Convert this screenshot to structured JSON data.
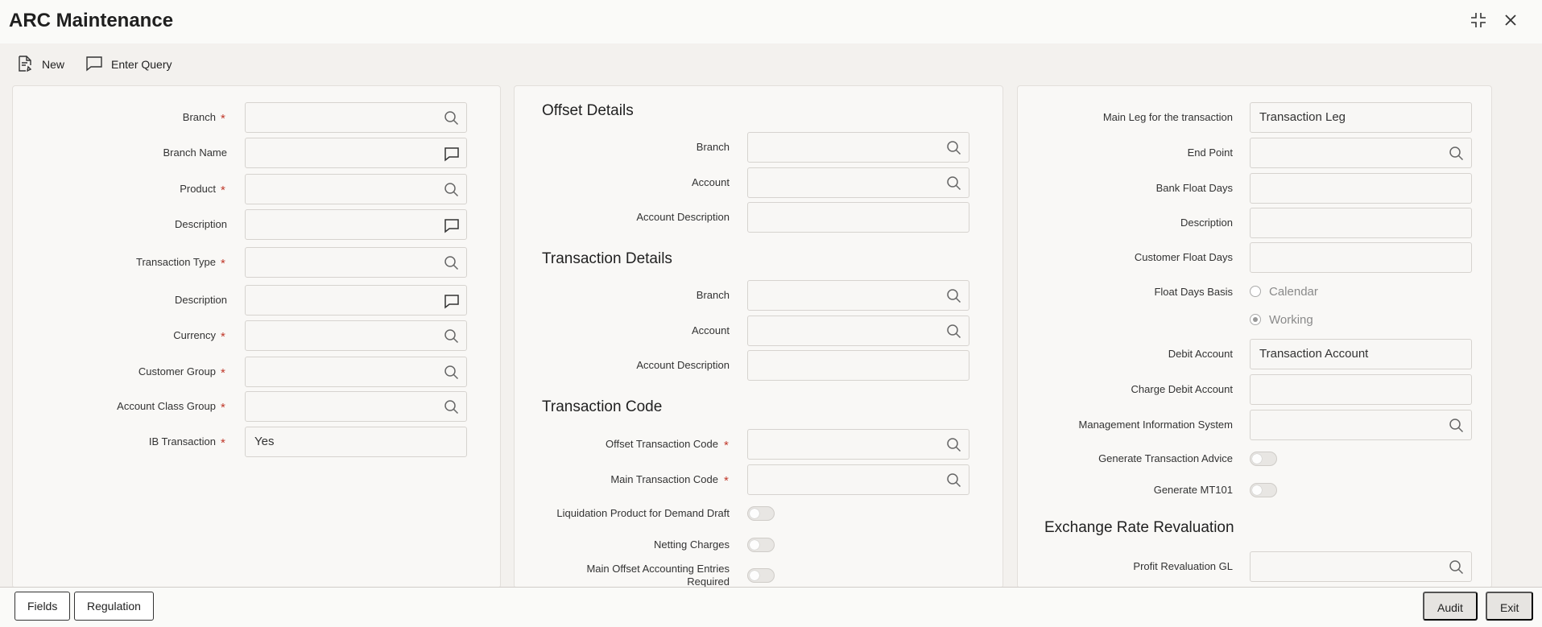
{
  "window": {
    "title": "ARC Maintenance"
  },
  "toolbar": {
    "new_label": "New",
    "enter_query_label": "Enter Query"
  },
  "panel1": {
    "branch": {
      "label": "Branch",
      "value": ""
    },
    "branch_name": {
      "label": "Branch Name",
      "value": ""
    },
    "product": {
      "label": "Product",
      "value": ""
    },
    "description1": {
      "label": "Description",
      "value": ""
    },
    "transaction_type": {
      "label": "Transaction Type",
      "value": ""
    },
    "description2": {
      "label": "Description",
      "value": ""
    },
    "currency": {
      "label": "Currency",
      "value": ""
    },
    "customer_group": {
      "label": "Customer Group",
      "value": ""
    },
    "account_class_group": {
      "label": "Account Class Group",
      "value": ""
    },
    "ib_transaction": {
      "label": "IB Transaction",
      "value": "Yes"
    }
  },
  "panel2": {
    "offset_title": "Offset Details",
    "offset_branch": {
      "label": "Branch",
      "value": ""
    },
    "offset_account": {
      "label": "Account",
      "value": ""
    },
    "offset_account_desc": {
      "label": "Account Description",
      "value": ""
    },
    "txn_title": "Transaction Details",
    "txn_branch": {
      "label": "Branch",
      "value": ""
    },
    "txn_account": {
      "label": "Account",
      "value": ""
    },
    "txn_account_desc": {
      "label": "Account Description",
      "value": ""
    },
    "code_title": "Transaction Code",
    "offset_txn_code": {
      "label": "Offset Transaction Code",
      "value": ""
    },
    "main_txn_code": {
      "label": "Main Transaction Code",
      "value": ""
    },
    "liquidation_label": "Liquidation Product for Demand Draft",
    "netting_label": "Netting Charges",
    "main_offset_label": "Main Offset Accounting Entries Required"
  },
  "panel3": {
    "main_leg": {
      "label": "Main Leg for the transaction",
      "value": "Transaction Leg"
    },
    "end_point": {
      "label": "End Point",
      "value": ""
    },
    "bank_float_days": {
      "label": "Bank Float Days",
      "value": ""
    },
    "description": {
      "label": "Description",
      "value": ""
    },
    "customer_float_days": {
      "label": "Customer Float Days",
      "value": ""
    },
    "float_days_basis": {
      "label": "Float Days Basis",
      "opt1": "Calendar",
      "opt2": "Working"
    },
    "debit_account": {
      "label": "Debit Account",
      "value": "Transaction Account"
    },
    "charge_debit_account": {
      "label": "Charge Debit Account",
      "value": ""
    },
    "mis": {
      "label": "Management Information System",
      "value": ""
    },
    "gen_advice_label": "Generate Transaction Advice",
    "gen_mt101_label": "Generate MT101",
    "exch_title": "Exchange Rate Revaluation",
    "profit_reval_gl": {
      "label": "Profit Revaluation GL",
      "value": ""
    }
  },
  "footer": {
    "fields_label": "Fields",
    "regulation_label": "Regulation",
    "audit_label": "Audit",
    "exit_label": "Exit"
  }
}
